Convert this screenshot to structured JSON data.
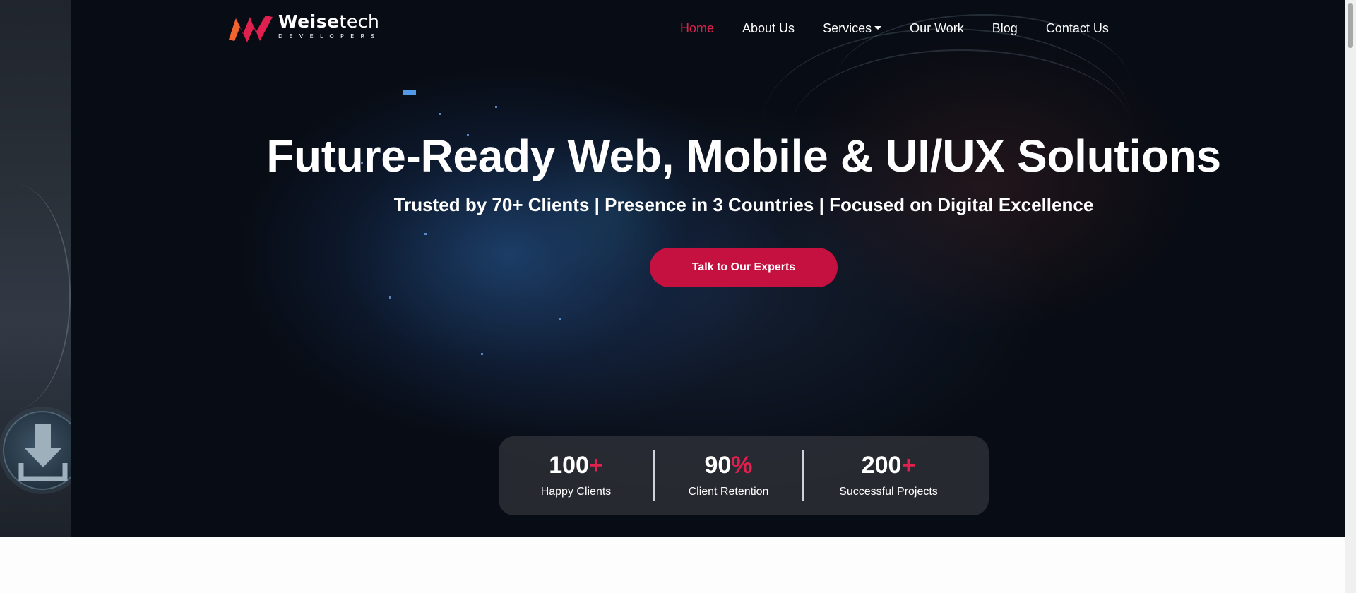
{
  "brand": {
    "name_bold": "Weise",
    "name_light": "tech",
    "tagline": "DEVELOPERS",
    "accent": "#e0214f"
  },
  "nav": {
    "items": [
      {
        "label": "Home",
        "active": true
      },
      {
        "label": "About Us"
      },
      {
        "label": "Services",
        "has_dropdown": true
      },
      {
        "label": "Our Work"
      },
      {
        "label": "Blog"
      },
      {
        "label": "Contact Us"
      }
    ]
  },
  "hero": {
    "headline": "Future-Ready Web, Mobile & UI/UX Solutions",
    "subline": "Trusted by 70+ Clients | Presence in 3 Countries | Focused on Digital Excellence",
    "cta_label": "Talk to Our Experts",
    "cta_color": "#c51140"
  },
  "stats": [
    {
      "value": "100",
      "suffix": "+",
      "label": "Happy Clients"
    },
    {
      "value": "90",
      "suffix": "%",
      "label": "Client Retention"
    },
    {
      "value": "200",
      "suffix": "+",
      "label": "Successful Projects"
    }
  ],
  "icons": {
    "download": "download-arrow-icon",
    "dropdown": "caret-down-icon"
  }
}
